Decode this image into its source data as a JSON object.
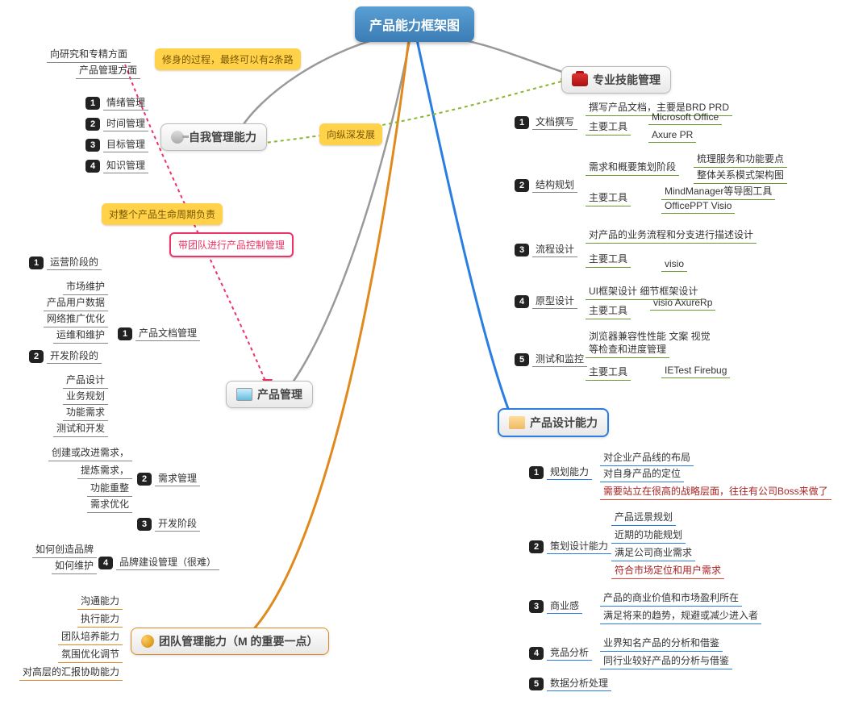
{
  "root": "产品能力框架图",
  "branches": {
    "prof": {
      "label": "专业技能管理"
    },
    "self": {
      "label": "自我管理能力"
    },
    "prod": {
      "label": "产品管理"
    },
    "design": {
      "label": "产品设计能力"
    },
    "team": {
      "label": "团队管理能力（M 的重要一点）"
    }
  },
  "callouts": {
    "c1": "修身的过程，最终可以有2条路",
    "c2": "向纵深发展",
    "c3": "对整个产品生命周期负责",
    "c4": "带团队进行产品控制管理"
  },
  "self_tips": {
    "t1": "向研究和专精方面",
    "t2": "产品管理方面"
  },
  "self_items": {
    "n1": "1",
    "l1": "情绪管理",
    "n2": "2",
    "l2": "时间管理",
    "n3": "3",
    "l3": "目标管理",
    "n4": "4",
    "l4": "知识管理"
  },
  "prof": {
    "i1n": "1",
    "i1": "文档撰写",
    "i1a": "撰写产品文档，主要是BRD  PRD",
    "i1b": "主要工具",
    "i1b1": "Microsoft Office",
    "i1b2": "Axure PR",
    "i2n": "2",
    "i2": "结构规划",
    "i2a": "需求和概要策划阶段",
    "i2a1": "梳理服务和功能要点",
    "i2a2": "整体关系模式架构图",
    "i2b": "主要工具",
    "i2b1": "MindManager等导图工具",
    "i2b2": "OfficePPT  Visio",
    "i3n": "3",
    "i3": "流程设计",
    "i3a": "对产品的业务流程和分支进行描述设计",
    "i3b": "主要工具",
    "i3b1": "visio",
    "i4n": "4",
    "i4": "原型设计",
    "i4a": "UI框架设计 细节框架设计",
    "i4b": "主要工具",
    "i4b1": "visio  AxureRp",
    "i5n": "5",
    "i5": "测试和监控",
    "i5a": "浏览器兼容性性能  文案 视觉",
    "i5a2": "等检查和进度管理",
    "i5b": "主要工具",
    "i5b1": "IETest  Firebug"
  },
  "prod": {
    "p1n": "1",
    "p1": "运营阶段的",
    "p1a": "市场维护",
    "p1b": "产品用户数据",
    "p1c": "网络推广优化",
    "p1d": "运维和维护",
    "p2n": "2",
    "p2": "开发阶段的",
    "p2a": "产品设计",
    "p2b": "业务规划",
    "p2c": "功能需求",
    "p2d": "测试和开发",
    "m1n": "1",
    "m1": "产品文档管理",
    "m2n": "2",
    "m2": "需求管理",
    "m2a": "创建或改进需求，",
    "m2b": "提炼需求，",
    "m2c": "功能重整",
    "m2d": "需求优化",
    "m3n": "3",
    "m3": "开发阶段",
    "m4n": "4",
    "m4": "品牌建设管理（很难）",
    "m4a": "如何创造品牌",
    "m4b": "如何维护"
  },
  "design": {
    "d1n": "1",
    "d1": "规划能力",
    "d1a": "对企业产品线的布局",
    "d1b": "对自身产品的定位",
    "d1c": "需要站立在很高的战略层面，往往有公司Boss来做了",
    "d2n": "2",
    "d2": "策划设计能力",
    "d2a": "产品远景规划",
    "d2b": "近期的功能规划",
    "d2c": "满足公司商业需求",
    "d2d": "符合市场定位和用户需求",
    "d3n": "3",
    "d3": "商业感",
    "d3a": "产品的商业价值和市场盈利所在",
    "d3b": "满足将来的趋势，规避或减少进入者",
    "d4n": "4",
    "d4": "竞品分析",
    "d4a": "业界知名产品的分析和借鉴",
    "d4b": "同行业较好产品的分析与借鉴",
    "d5n": "5",
    "d5": "数据分析处理"
  },
  "team": {
    "t1": "沟通能力",
    "t2": "执行能力",
    "t3": "团队培养能力",
    "t4": "氛围优化调节",
    "t5": "对高层的汇报协助能力"
  }
}
